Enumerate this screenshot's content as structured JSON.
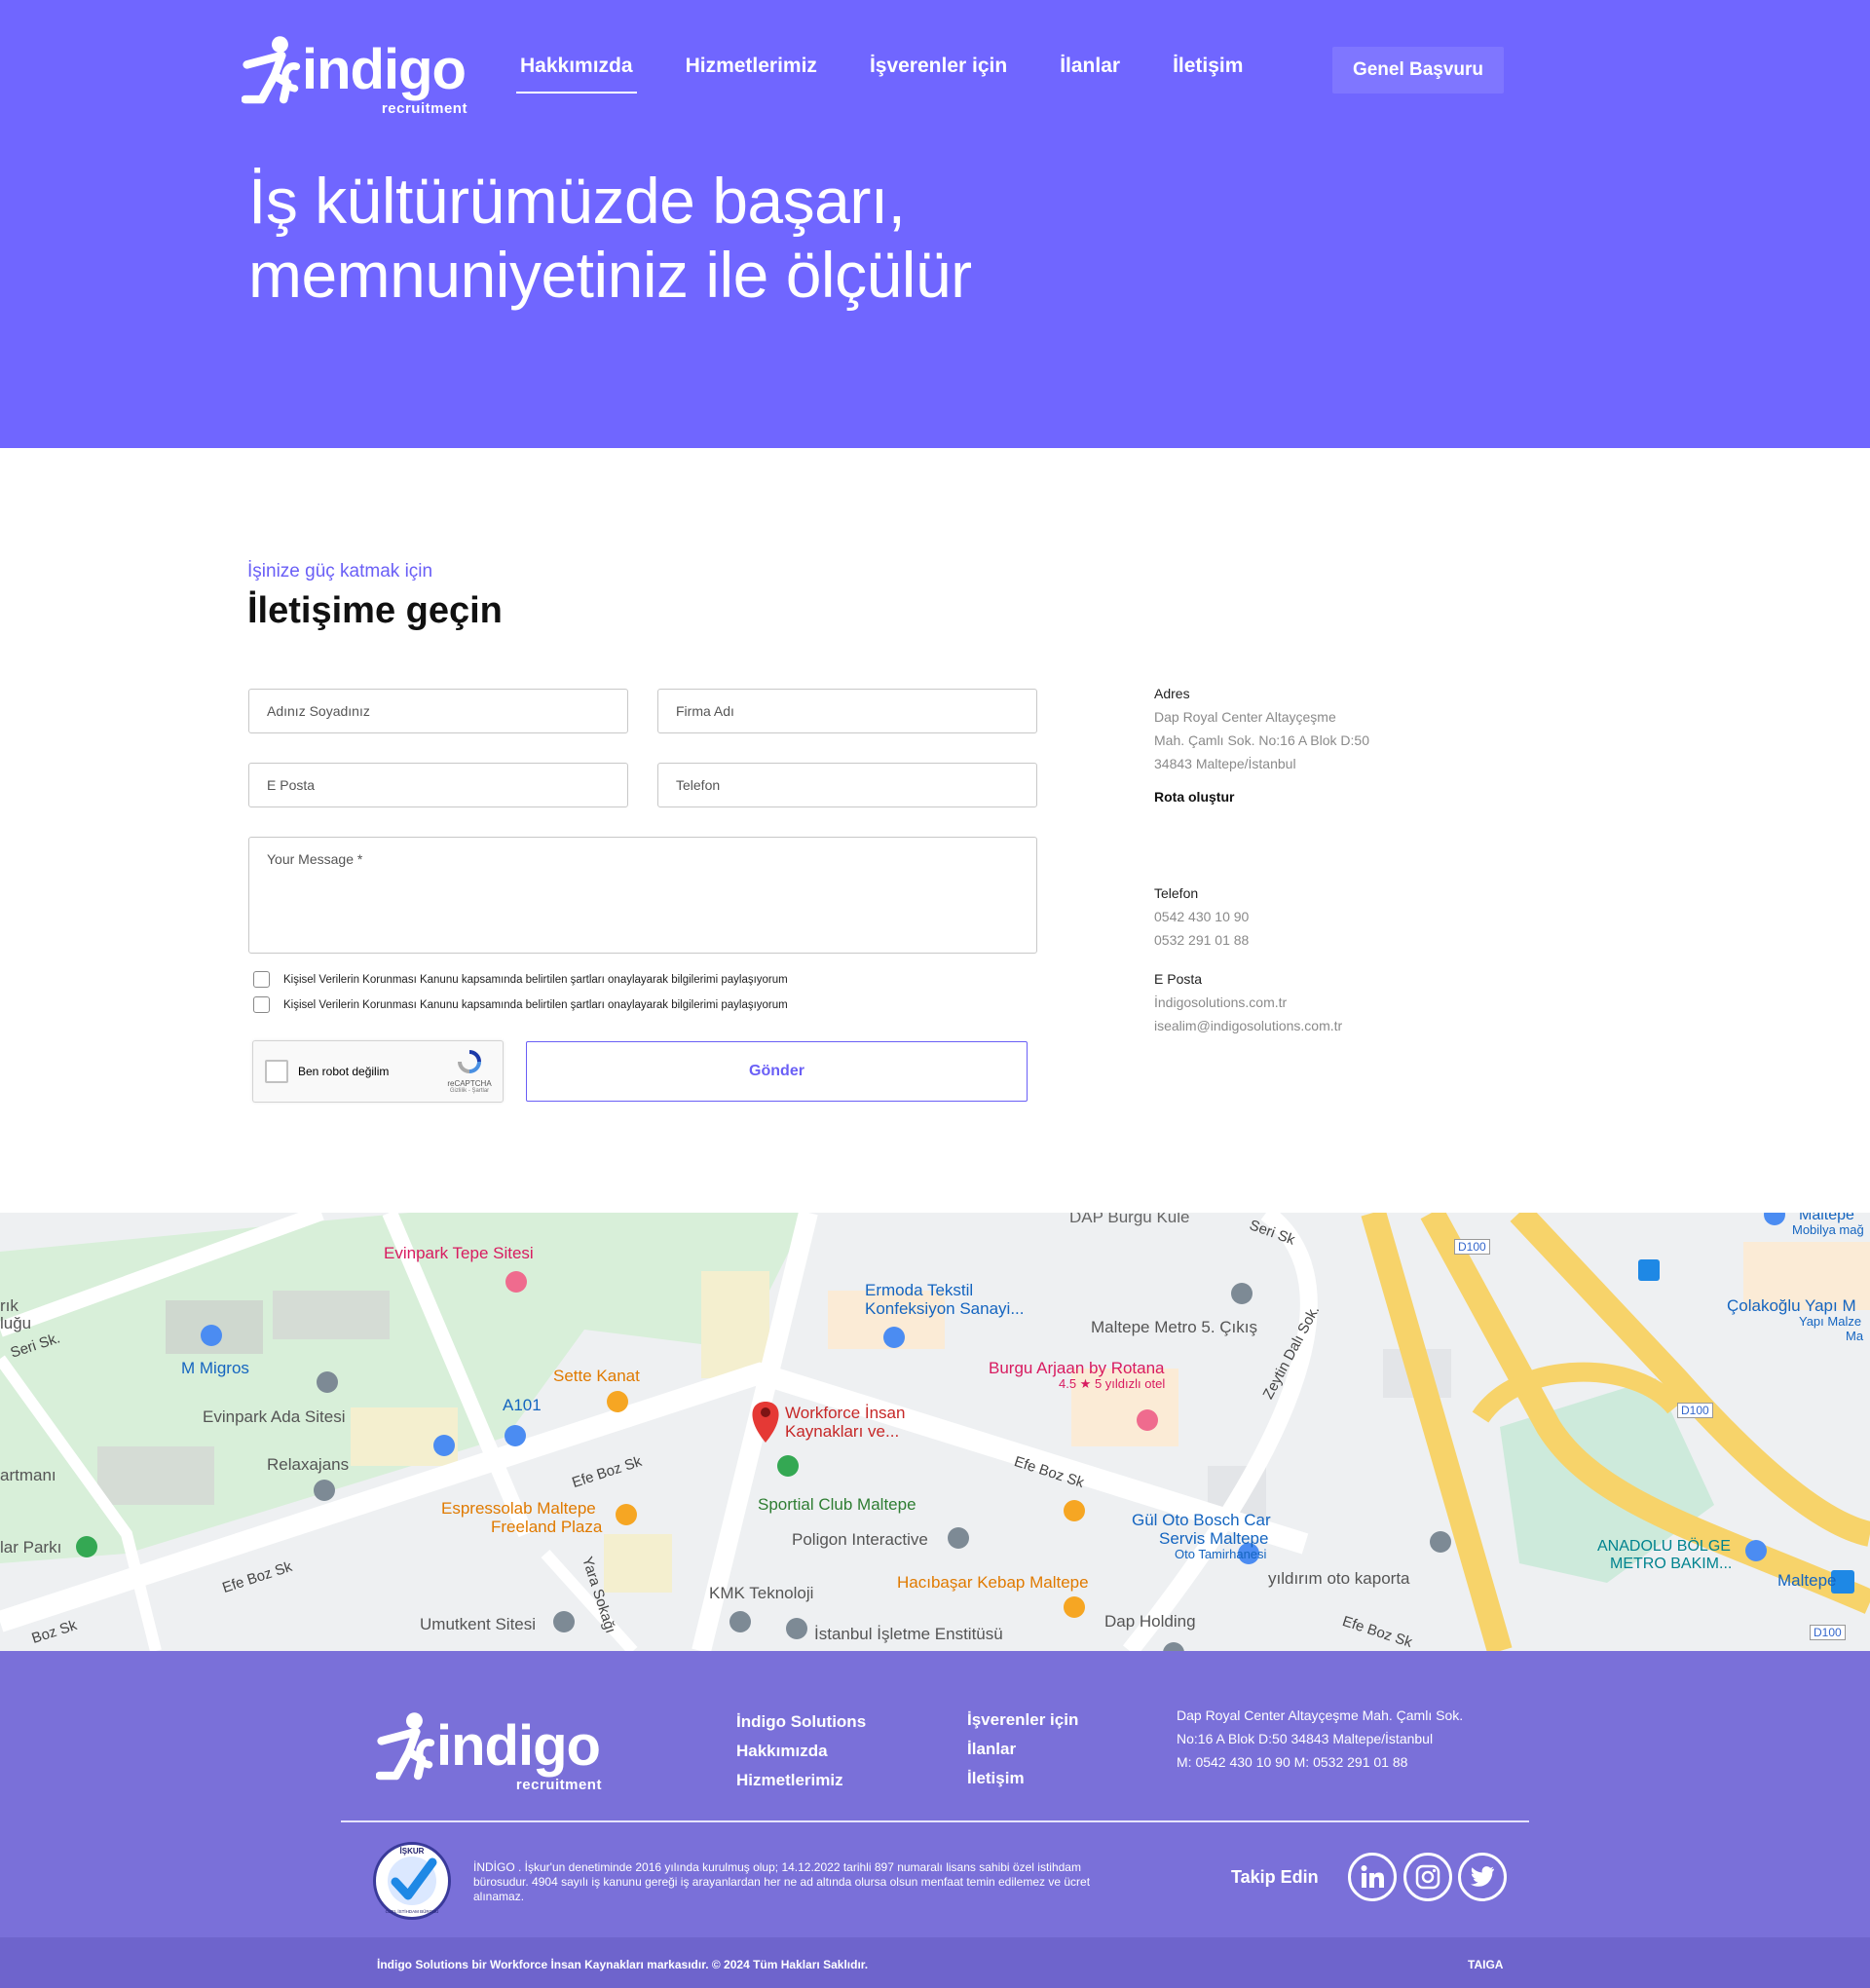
{
  "header": {
    "logo_word": "indigo",
    "logo_sub": "recruitment",
    "nav": [
      "Hakkımızda",
      "Hizmetlerimiz",
      "İşverenler için",
      "İlanlar",
      "İletişim"
    ],
    "apply_button": "Genel Başvuru",
    "headline_line1": "İş kültürümüzde başarı,",
    "headline_line2": "memnuniyetiniz ile ölçülür"
  },
  "contact": {
    "eyebrow": "İşinize güç katmak için",
    "title": "İletişime geçin",
    "placeholders": {
      "name": "Adınız Soyadınız",
      "company": "Firma Adı",
      "email": "E Posta",
      "phone": "Telefon",
      "message": "Your Message *"
    },
    "consents": [
      "Kişisel Verilerin Korunması Kanunu kapsamında belirtilen şartları onaylayarak bilgilerimi paylaşıyorum",
      "Kişisel Verilerin Korunması Kanunu kapsamında belirtilen şartları onaylayarak bilgilerimi paylaşıyorum"
    ],
    "captcha": {
      "label": "Ben robot değilim",
      "brand": "reCAPTCHA",
      "terms": "Gizlilik - Şartlar"
    },
    "send_button": "Gönder"
  },
  "info": {
    "address_heading": "Adres",
    "address_lines": [
      "Dap Royal Center Altayçeşme",
      "Mah. Çamlı Sok. No:16 A Blok D:50",
      "34843  Maltepe/İstanbul"
    ],
    "route_link": "Rota oluştur",
    "phone_heading": "Telefon",
    "phones": [
      "0542 430 10 90",
      "0532 291 01 88"
    ],
    "email_heading": "E Posta",
    "emails": [
      "İndigosolutions.com.tr",
      "isealim@indigosolutions.com.tr"
    ]
  },
  "map": {
    "places": {
      "evinpark": "Evinpark Tepe Sitesi",
      "migros": "M Migros",
      "evinpark_ada": "Evinpark Ada Sitesi",
      "relaxajans": "Relaxajans",
      "sette": "Sette Kanat",
      "a101": "A101",
      "ermoda1": "Ermoda Tekstil",
      "ermoda2": "Konfeksiyon Sanayi...",
      "metro_exit": "Maltepe Metro 5. Çıkış",
      "burgu1": "Burgu Arjaan by Rotana",
      "burgu2": "4.5 ★ 5 yıldızlı otel",
      "workforce1": "Workforce İnsan",
      "workforce2": "Kaynakları ve...",
      "sportial": "Sportial Club Maltepe",
      "espresso1": "Espressolab Maltepe",
      "espresso2": "Freeland Plaza",
      "poligon": "Poligon Interactive",
      "gul1": "Gül Oto Bosch Car",
      "gul2": "Servis Maltepe",
      "gul3": "Oto Tamirhanesi",
      "anadolu1": "ANADOLU BÖLGE",
      "anadolu2": "METRO BAKIM...",
      "kmk": "KMK Teknoloji",
      "hacibasar": "Hacıbaşar Kebap Maltepe",
      "yildirim": "yıldırım oto kaporta",
      "umutkent": "Umutkent Sitesi",
      "dap_holding": "Dap Holding",
      "isletme": "İstanbul İşletme Enstitüsü",
      "colakoglu1": "Çolakoğlu Yapı M",
      "colakoglu2": "Yapı Malze",
      "colakoglu3": "Ma",
      "maltepe_top1": "Maltepe",
      "maltepe_top2": "Mobilya mağ",
      "maltepe_m": "Maltepe",
      "dap_burgu": "DAP Burgu Kule",
      "parki": "lar Parkı",
      "artmani": "artmanı",
      "rik1": "rık",
      "rik2": "luğu"
    },
    "roads": {
      "seri1": "Seri Sk.",
      "seri2": "Seri Sk",
      "efe1": "Efe Boz Sk",
      "efe2": "Efe Boz Sk",
      "efe3": "Efe Boz Sk",
      "efe4": "Efe Boz Sk",
      "efe5": "Boz Sk",
      "yara": "Yara Sokağı",
      "zeytin": "Zeytin Dalı Sok.",
      "d100": "D100"
    }
  },
  "footer": {
    "col1": [
      "İndigo Solutions",
      "Hakkımızda",
      "Hizmetlerimiz"
    ],
    "col2": [
      "İşverenler için",
      "İlanlar",
      "İletişim"
    ],
    "address_lines": [
      "Dap Royal Center Altayçeşme Mah. Çamlı Sok.",
      "No:16 A Blok D:50 34843        Maltepe/İstanbul",
      "M: 0542 430 10 90    M: 0532 291 01 88"
    ],
    "badge_top": "İŞKUR",
    "badge_bottom": "ÖZEL İSTİHDAM BÜROSU",
    "legal": "İNDİGO . İşkur'un denetiminde 2016 yılında kurulmuş olup; 14.12.2022 tarihli 897 numaralı lisans sahibi özel istihdam bürosudur. 4904 sayılı iş kanunu gereği iş arayanlardan her ne ad altında olursa olsun menfaat temin edilemez ve ücret alınamaz.",
    "follow": "Takip Edin",
    "social": [
      "linkedin-icon",
      "instagram-icon",
      "twitter-icon"
    ],
    "copyright": "İndigo Solutions bir Workforce İnsan Kaynakları markasıdır.  © 2024 Tüm Hakları Saklıdır.",
    "credit": "TAIGA"
  },
  "colors": {
    "brand": "#7066ff",
    "footer": "#7a70d9",
    "bottombar": "#6e64cc",
    "accent_text": "#6a5ff6"
  }
}
